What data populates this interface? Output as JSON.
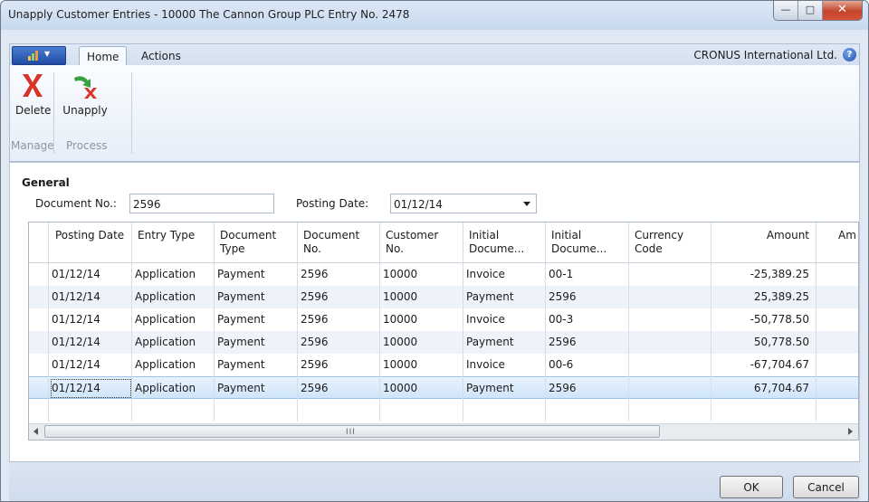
{
  "window": {
    "title": "Unapply Customer Entries - 10000 The Cannon Group PLC Entry No. 2478",
    "minimize_icon": "minimize-icon",
    "maximize_icon": "maximize-icon",
    "close_icon": "close-icon"
  },
  "ribbon": {
    "tabs": [
      "Home",
      "Actions"
    ],
    "active_tab": "Home",
    "company": "CRONUS International Ltd.",
    "help_glyph": "?",
    "groups": [
      {
        "label": "Manage",
        "buttons": [
          {
            "label": "Delete",
            "icon": "delete-x-icon"
          }
        ]
      },
      {
        "label": "Process",
        "buttons": [
          {
            "label": "Unapply",
            "icon": "unapply-arrow-icon"
          }
        ]
      }
    ]
  },
  "general": {
    "title": "General",
    "document_no_label": "Document No.:",
    "document_no_value": "2596",
    "posting_date_label": "Posting Date:",
    "posting_date_value": "01/12/14"
  },
  "table": {
    "columns": [
      [
        "Posting Date"
      ],
      [
        "Entry Type"
      ],
      [
        "Document",
        "Type"
      ],
      [
        "Document",
        "No."
      ],
      [
        "Customer",
        "No."
      ],
      [
        "Initial",
        "Docume..."
      ],
      [
        "Initial",
        "Docume..."
      ],
      [
        "Currency",
        "Code"
      ],
      [
        "Amount"
      ],
      [
        "Am"
      ]
    ],
    "rows": [
      [
        "01/12/14",
        "Application",
        "Payment",
        "2596",
        "10000",
        "Invoice",
        "00-1",
        "",
        "-25,389.25"
      ],
      [
        "01/12/14",
        "Application",
        "Payment",
        "2596",
        "10000",
        "Payment",
        "2596",
        "",
        "25,389.25"
      ],
      [
        "01/12/14",
        "Application",
        "Payment",
        "2596",
        "10000",
        "Invoice",
        "00-3",
        "",
        "-50,778.50"
      ],
      [
        "01/12/14",
        "Application",
        "Payment",
        "2596",
        "10000",
        "Payment",
        "2596",
        "",
        "50,778.50"
      ],
      [
        "01/12/14",
        "Application",
        "Payment",
        "2596",
        "10000",
        "Invoice",
        "00-6",
        "",
        "-67,704.67"
      ],
      [
        "01/12/14",
        "Application",
        "Payment",
        "2596",
        "10000",
        "Payment",
        "2596",
        "",
        "67,704.67"
      ]
    ],
    "selected_row": 5,
    "scroll_grip": "III"
  },
  "buttons": {
    "ok": "OK",
    "cancel": "Cancel"
  },
  "colors": {
    "selection": "#cfe5f9",
    "alt_row": "#eef3fa",
    "delete_icon": "#d8342a",
    "unapply_icon": "#3aa142"
  }
}
